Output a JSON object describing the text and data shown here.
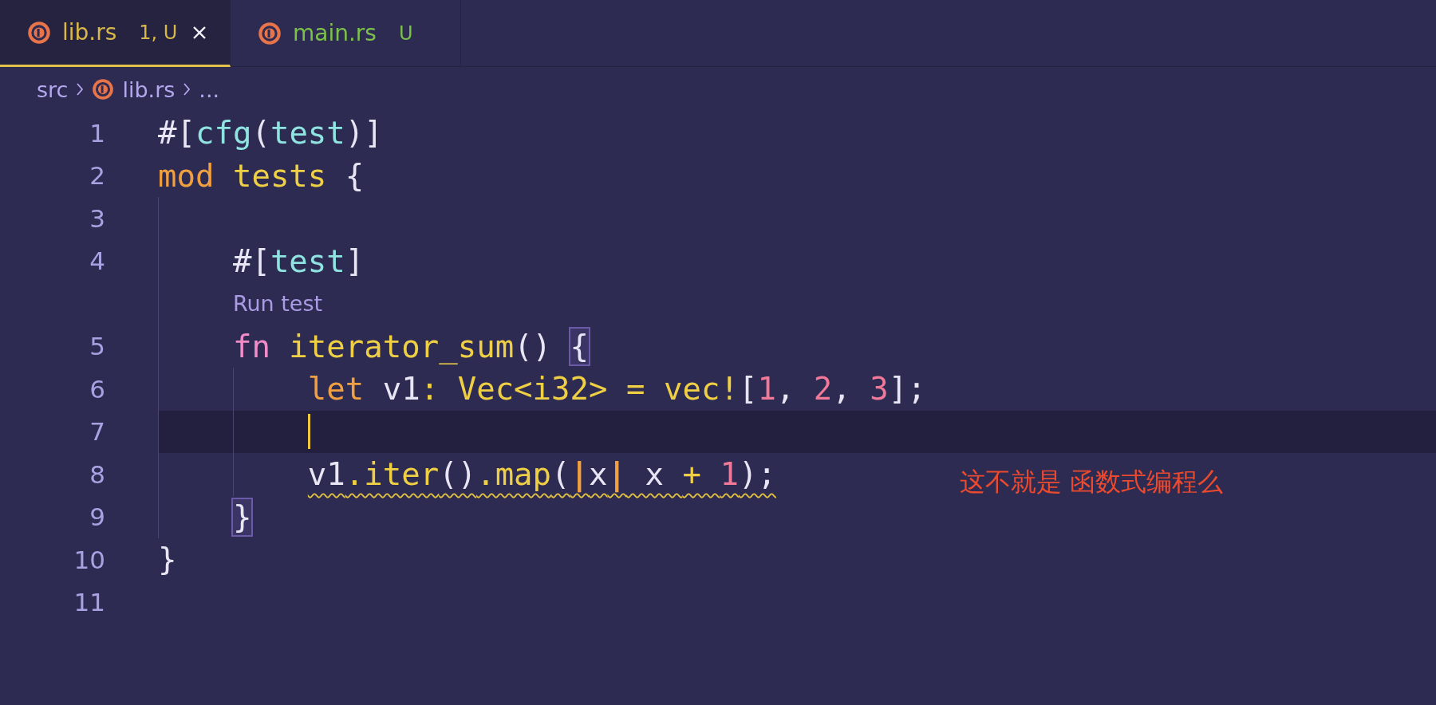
{
  "tabs": [
    {
      "label": "lib.rs",
      "status": "1, U",
      "color": "#d8b84a",
      "selected": true
    },
    {
      "label": "main.rs",
      "status": "U",
      "color": "#7cc24a",
      "selected": false
    }
  ],
  "breadcrumb": [
    "src",
    "lib.rs",
    "..."
  ],
  "lines": [
    {
      "kind": "code",
      "number": "1",
      "current": false,
      "warning": false,
      "tokens": [
        {
          "text": "#[",
          "kind": "punct"
        },
        {
          "text": "cfg",
          "kind": "attribute"
        },
        {
          "text": "(",
          "kind": "punct"
        },
        {
          "text": "test",
          "kind": "attribute"
        },
        {
          "text": ")]",
          "kind": "punct"
        }
      ]
    },
    {
      "kind": "code",
      "number": "2",
      "current": false,
      "warning": false,
      "tokens": [
        {
          "text": "mod ",
          "kind": "keyword"
        },
        {
          "text": "tests ",
          "kind": "function"
        },
        {
          "text": "{",
          "kind": "punct"
        }
      ],
      "children": [
        {
          "kind": "code",
          "number": "3",
          "current": false
        },
        {
          "kind": "code",
          "number": "4",
          "current": false,
          "warning": false,
          "tokens": [
            {
              "text": "#[",
              "kind": "punct"
            },
            {
              "text": "test",
              "kind": "attribute"
            },
            {
              "text": "]",
              "kind": "punct"
            }
          ]
        },
        {
          "kind": "codelens",
          "text": "Run test"
        },
        {
          "kind": "code",
          "number": "5",
          "current": false,
          "warning": false,
          "tokens": [
            {
              "text": "fn ",
              "kind": "storage"
            },
            {
              "text": "iterator_sum",
              "kind": "function"
            },
            {
              "text": "() ",
              "kind": "punct"
            },
            {
              "text": "{",
              "kind": "bracket-match"
            }
          ],
          "children": [
            {
              "kind": "code",
              "number": "6",
              "current": false,
              "warning": false,
              "tokens": [
                {
                  "text": "let",
                  "kind": "keyword"
                },
                {
                  "text": " v1",
                  "kind": "punct"
                },
                {
                  "text": ": Vec<i32> = vec!",
                  "kind": "function"
                },
                {
                  "text": "[",
                  "kind": "punct"
                },
                {
                  "text": "1",
                  "kind": "number"
                },
                {
                  "text": ", ",
                  "kind": "punct"
                },
                {
                  "text": "2",
                  "kind": "number"
                },
                {
                  "text": ", ",
                  "kind": "punct"
                },
                {
                  "text": "3",
                  "kind": "number"
                },
                {
                  "text": "];",
                  "kind": "punct"
                }
              ]
            },
            {
              "kind": "code",
              "number": "7",
              "current": true
            },
            {
              "kind": "code",
              "number": "8",
              "current": false,
              "warning": true,
              "tokens": [
                {
                  "text": "v1",
                  "kind": "punct"
                },
                {
                  "text": ".iter",
                  "kind": "function"
                },
                {
                  "text": "()",
                  "kind": "punct"
                },
                {
                  "text": ".map",
                  "kind": "function"
                },
                {
                  "text": "(",
                  "kind": "punct"
                },
                {
                  "text": "|",
                  "kind": "pipe"
                },
                {
                  "text": "x",
                  "kind": "punct"
                },
                {
                  "text": "|",
                  "kind": "pipe"
                },
                {
                  "text": " x ",
                  "kind": "punct"
                },
                {
                  "text": "+ ",
                  "kind": "function"
                },
                {
                  "text": "1",
                  "kind": "number"
                },
                {
                  "text": ");",
                  "kind": "punct"
                }
              ]
            }
          ]
        },
        {
          "kind": "code",
          "number": "9",
          "current": false,
          "warning": false,
          "tokens": [
            {
              "text": "}",
              "kind": "bracket-match"
            }
          ]
        }
      ]
    },
    {
      "kind": "code",
      "number": "10",
      "current": false,
      "warning": false,
      "tokens": [
        {
          "text": "}",
          "kind": "punct"
        }
      ]
    },
    {
      "kind": "code",
      "number": "11",
      "current": false
    }
  ],
  "annotation": "这不就是 函数式编程么"
}
